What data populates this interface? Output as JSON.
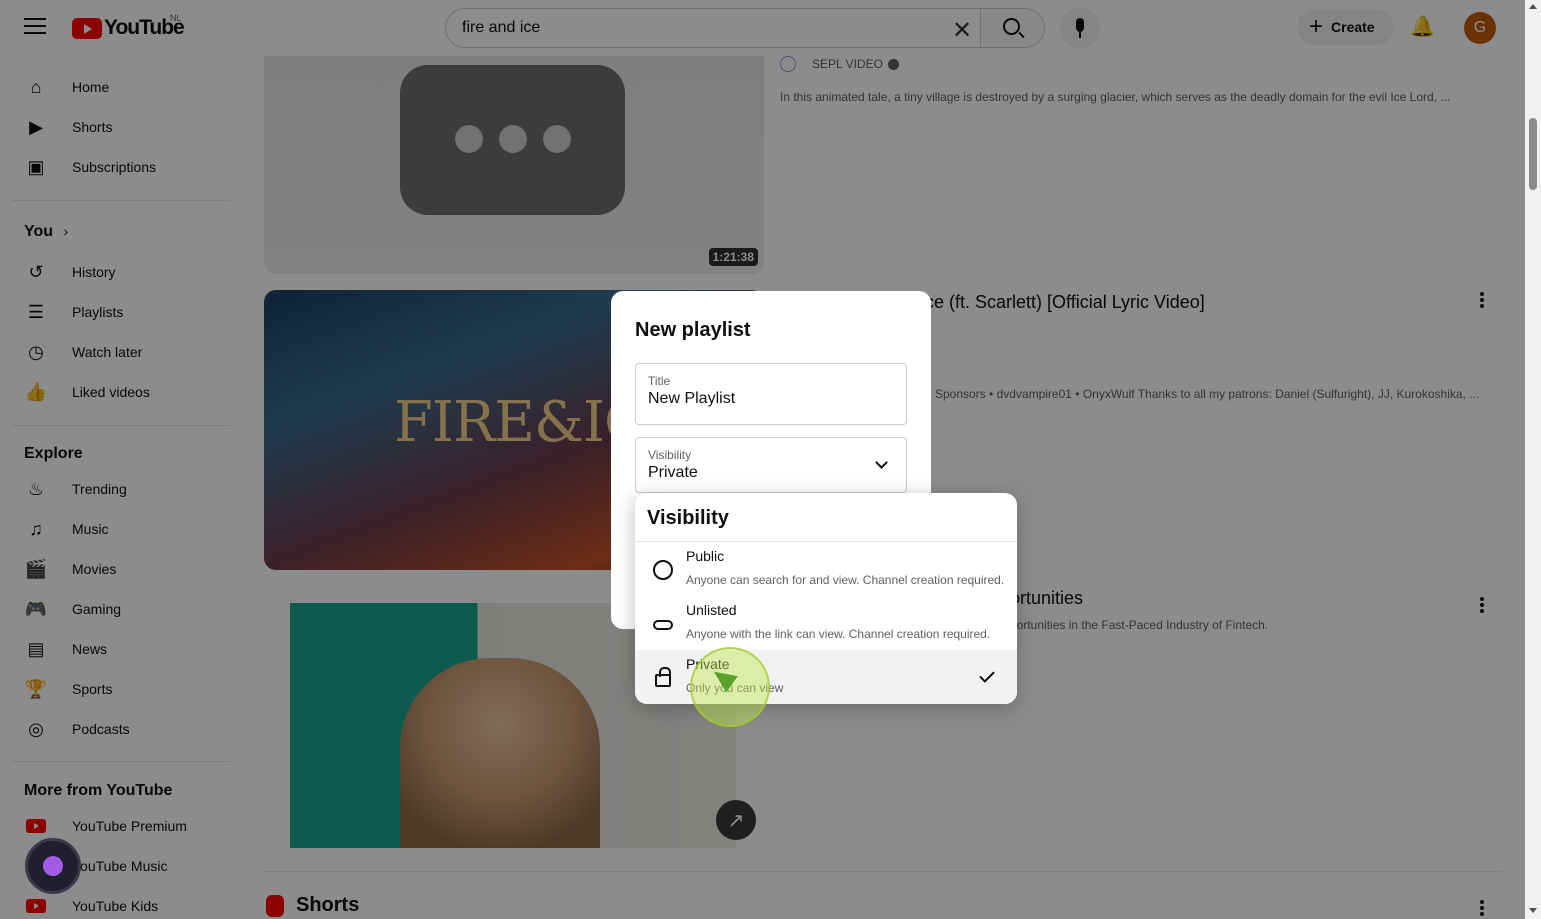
{
  "header": {
    "logo_text": "YouTube",
    "region": "NL",
    "search_value": "fire and ice",
    "create_label": "Create",
    "avatar_letter": "G"
  },
  "sidebar": {
    "top_items": [
      {
        "label": "Home",
        "icon": "home-icon"
      },
      {
        "label": "Shorts",
        "icon": "shorts-icon"
      },
      {
        "label": "Subscriptions",
        "icon": "subscriptions-icon"
      }
    ],
    "you_heading": "You",
    "you_items": [
      {
        "label": "History",
        "icon": "history-icon"
      },
      {
        "label": "Playlists",
        "icon": "playlists-icon"
      },
      {
        "label": "Watch later",
        "icon": "clock-icon"
      },
      {
        "label": "Liked videos",
        "icon": "thumbs-up-icon"
      }
    ],
    "explore_heading": "Explore",
    "explore_items": [
      {
        "label": "Trending",
        "icon": "flame-icon"
      },
      {
        "label": "Music",
        "icon": "music-note-icon"
      },
      {
        "label": "Movies",
        "icon": "clapper-icon"
      },
      {
        "label": "Gaming",
        "icon": "gamepad-icon"
      },
      {
        "label": "News",
        "icon": "newspaper-icon"
      },
      {
        "label": "Sports",
        "icon": "trophy-icon"
      },
      {
        "label": "Podcasts",
        "icon": "podcast-icon"
      }
    ],
    "more_heading": "More from YouTube",
    "more_items": [
      {
        "label": "YouTube Premium"
      },
      {
        "label": "YouTube Music"
      },
      {
        "label": "YouTube Kids"
      }
    ]
  },
  "results": [
    {
      "channel": "SEPL VIDEO",
      "description": "In this animated tale, a tiny village is destroyed by a surging glacier, which serves as the deadly domain for the evil Ice Lord, ...",
      "duration": "1:21:38"
    },
    {
      "title_visible": "ce (ft. Scarlett) [Official Lyric Video]",
      "description_visible": "n Sponsors • dvdvampire01 • OnyxWulf Thanks to all my patrons: Daniel (Sulfuright), JJ, Kurokoshika, ...",
      "thumb_text": "FIRE&IC"
    },
    {
      "title_visible": "ortunities",
      "description_visible": "portunities in the Fast-Paced Industry of Fintech."
    }
  ],
  "shorts_heading": "Shorts",
  "dialog": {
    "title": "New playlist",
    "title_field_label": "Title",
    "title_field_value": "New Playlist",
    "visibility_field_label": "Visibility",
    "visibility_field_value": "Private"
  },
  "visibility_menu": {
    "heading": "Visibility",
    "options": [
      {
        "label": "Public",
        "sub": "Anyone can search for and view. Channel creation required.",
        "icon": "globe-icon",
        "selected": false
      },
      {
        "label": "Unlisted",
        "sub": "Anyone with the link can view. Channel creation required.",
        "icon": "link-icon",
        "selected": false
      },
      {
        "label": "Private",
        "sub": "Only you can view",
        "icon": "lock-icon",
        "selected": true
      }
    ]
  },
  "colors": {
    "brand_red": "#ff0000",
    "avatar_bg": "#c45a0b",
    "click_indicator": "#5aa32b"
  }
}
